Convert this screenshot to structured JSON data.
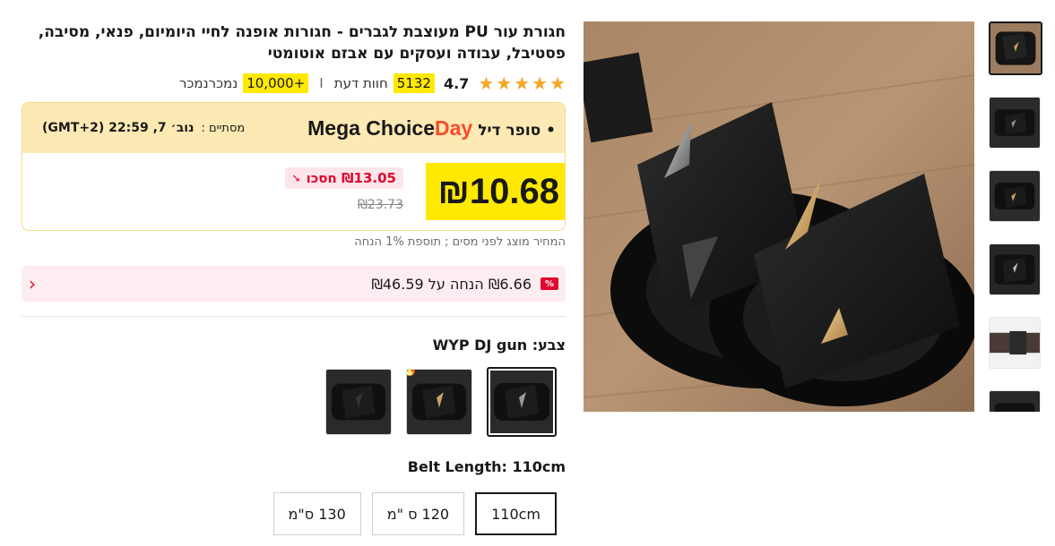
{
  "product": {
    "title": "חגורת עור PU מעוצבת לגברים - חגורות אופנה לחיי היומיום, פנאי, מסיבה, פסטיבל, עבודה ועסקים עם אבזם אוטומטי"
  },
  "rating": {
    "value": "4.7",
    "stars": 5,
    "reviews_count": "5132",
    "reviews_label": "חוות דעת",
    "sold_count": "+10,000",
    "sold_label": "נמכרנמכר",
    "separator": "I"
  },
  "deal": {
    "brand_main": "Mega Choice",
    "brand_day": "Day",
    "name": "• סופר דיל",
    "ends_label": "מסתיים :",
    "ends_time": "נוב׳ 7, 22:59 (GMT+2)"
  },
  "price": {
    "current": "₪10.68",
    "save_text": "₪13.05 חסכו",
    "original": "₪23.73"
  },
  "tax_note": "המחיר מוצג לפני מסים ; תוספת 1% הנחה",
  "coupon": {
    "icon_text": "%",
    "text": "₪6.66 הנחה על ₪46.59"
  },
  "color": {
    "label": "צבע: WYP DJ gun",
    "options": [
      {
        "name": "silver-tip",
        "selected": true,
        "hot": false
      },
      {
        "name": "gold-tip",
        "selected": false,
        "hot": true
      },
      {
        "name": "black-plain",
        "selected": false,
        "hot": false
      }
    ]
  },
  "length": {
    "label": "Belt Length: 110cm",
    "options": [
      {
        "label": "110cm",
        "selected": true
      },
      {
        "label": "120 ס \"מ",
        "selected": false
      },
      {
        "label": "130 ס\"מ",
        "selected": false
      }
    ]
  },
  "gallery": {
    "thumbnail_count": 6,
    "active_index": 0
  },
  "colors": {
    "highlight": "#ffe900",
    "accent_red": "#e1062d",
    "deal_bg": "#fde9b3",
    "star": "#f5a623"
  }
}
